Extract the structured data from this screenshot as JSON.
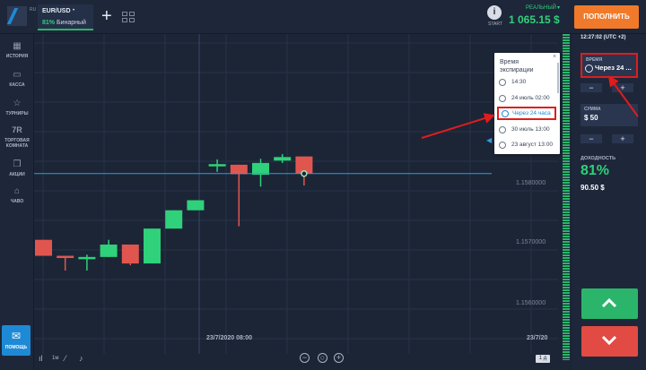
{
  "topbar": {
    "logo_suffix": "RU",
    "asset": {
      "name": "EUR/USD",
      "caret": "•",
      "payout": "81%",
      "type": "Бинарный"
    },
    "add_asset": "+",
    "start_icon": "i",
    "start_label": "START",
    "account_label": "РЕАЛЬНЫЙ",
    "account_caret": "▾",
    "balance": "1 065.15 $",
    "topup_label": "ПОПОЛНИТЬ"
  },
  "sidebar": {
    "items": [
      {
        "label": "ИСТОРИЯ",
        "icon": "history-icon",
        "glyph": "▦"
      },
      {
        "label": "КАССА",
        "icon": "wallet-icon",
        "glyph": "▭"
      },
      {
        "label": "ТУРНИРЫ",
        "icon": "star-icon",
        "glyph": "☆"
      },
      {
        "label": "ТОРГОВАЯ КОМНАТА",
        "icon": "trading-room-icon",
        "glyph": "7R"
      },
      {
        "label": "АКЦИИ",
        "icon": "gift-icon",
        "glyph": "❒"
      },
      {
        "label": "ЧАВО",
        "icon": "graduation-cap-icon",
        "glyph": "⌂"
      }
    ],
    "settings_glyph": "⚙",
    "sound_glyph": "◁",
    "help_label": "ПОМОЩЬ",
    "help_glyph": "✉"
  },
  "chart": {
    "y_ticks": [
      "1.1580000",
      "1.1570000",
      "1.1560000"
    ],
    "time_label": "23/7/2020 08:00",
    "time_label_2": "23/7/20",
    "current_price_marker": "◀"
  },
  "chart_data": {
    "type": "candlestick",
    "y_ticks": [
      1.158,
      1.157,
      1.156
    ],
    "candles": [
      {
        "o": 1.15705,
        "c": 1.15678,
        "h": 1.15705,
        "l": 1.15678,
        "dir": "down"
      },
      {
        "o": 1.15678,
        "c": 1.15675,
        "h": 1.15678,
        "l": 1.15653,
        "dir": "down"
      },
      {
        "o": 1.15674,
        "c": 1.15676,
        "h": 1.1568,
        "l": 1.15653,
        "dir": "up"
      },
      {
        "o": 1.15676,
        "c": 1.15697,
        "h": 1.15705,
        "l": 1.15676,
        "dir": "up"
      },
      {
        "o": 1.15697,
        "c": 1.15665,
        "h": 1.15697,
        "l": 1.15662,
        "dir": "down"
      },
      {
        "o": 1.15665,
        "c": 1.15724,
        "h": 1.15724,
        "l": 1.15665,
        "dir": "up"
      },
      {
        "o": 1.15724,
        "c": 1.15755,
        "h": 1.15755,
        "l": 1.15724,
        "dir": "up"
      },
      {
        "o": 1.15755,
        "c": 1.15772,
        "h": 1.15772,
        "l": 1.15755,
        "dir": "up"
      },
      {
        "o": 1.15833,
        "c": 1.15831,
        "h": 1.15841,
        "l": 1.1582,
        "dir": "up"
      },
      {
        "o": 1.15832,
        "c": 1.15816,
        "h": 1.15832,
        "l": 1.15728,
        "dir": "down"
      },
      {
        "o": 1.15815,
        "c": 1.15835,
        "h": 1.15842,
        "l": 1.15795,
        "dir": "up"
      },
      {
        "o": 1.15839,
        "c": 1.15845,
        "h": 1.1585,
        "l": 1.15835,
        "dir": "up"
      },
      {
        "o": 1.15846,
        "c": 1.15817,
        "h": 1.15846,
        "l": 1.15797,
        "dir": "down"
      }
    ],
    "current_price": 1.15817
  },
  "bottombar": {
    "candle_type_glyph": "ıl",
    "timeframe_small": "1м",
    "draw_glyph": "⁄",
    "indicator_glyph": "♪",
    "zoom_out": "−",
    "zoom_reset": "○",
    "zoom_in": "+",
    "timeframe_btn": "1 д"
  },
  "rightpanel": {
    "clock": "12:27:02 (UTC +2)",
    "time_label": "ВРЕМЯ",
    "time_value": "Через 24 ...",
    "minus": "−",
    "plus": "+",
    "amount_label": "СУММА",
    "amount_value": "$  50",
    "profit_label": "ДОХОДНОСТЬ",
    "profit_pct": "81%",
    "profit_amount": "90.50 $"
  },
  "popup": {
    "close": "×",
    "title": "Время экспирации",
    "items": [
      "14:30",
      "24 июль 02:00",
      "Через 24 часа",
      "30 июль 13:00",
      "23 август 13:00"
    ],
    "selected_index": 2
  },
  "colors": {
    "up": "#2fd17a",
    "down": "#e0564f",
    "accent": "#1e8ad6",
    "highlight": "#e01c1c",
    "topup": "#f07a2a"
  }
}
